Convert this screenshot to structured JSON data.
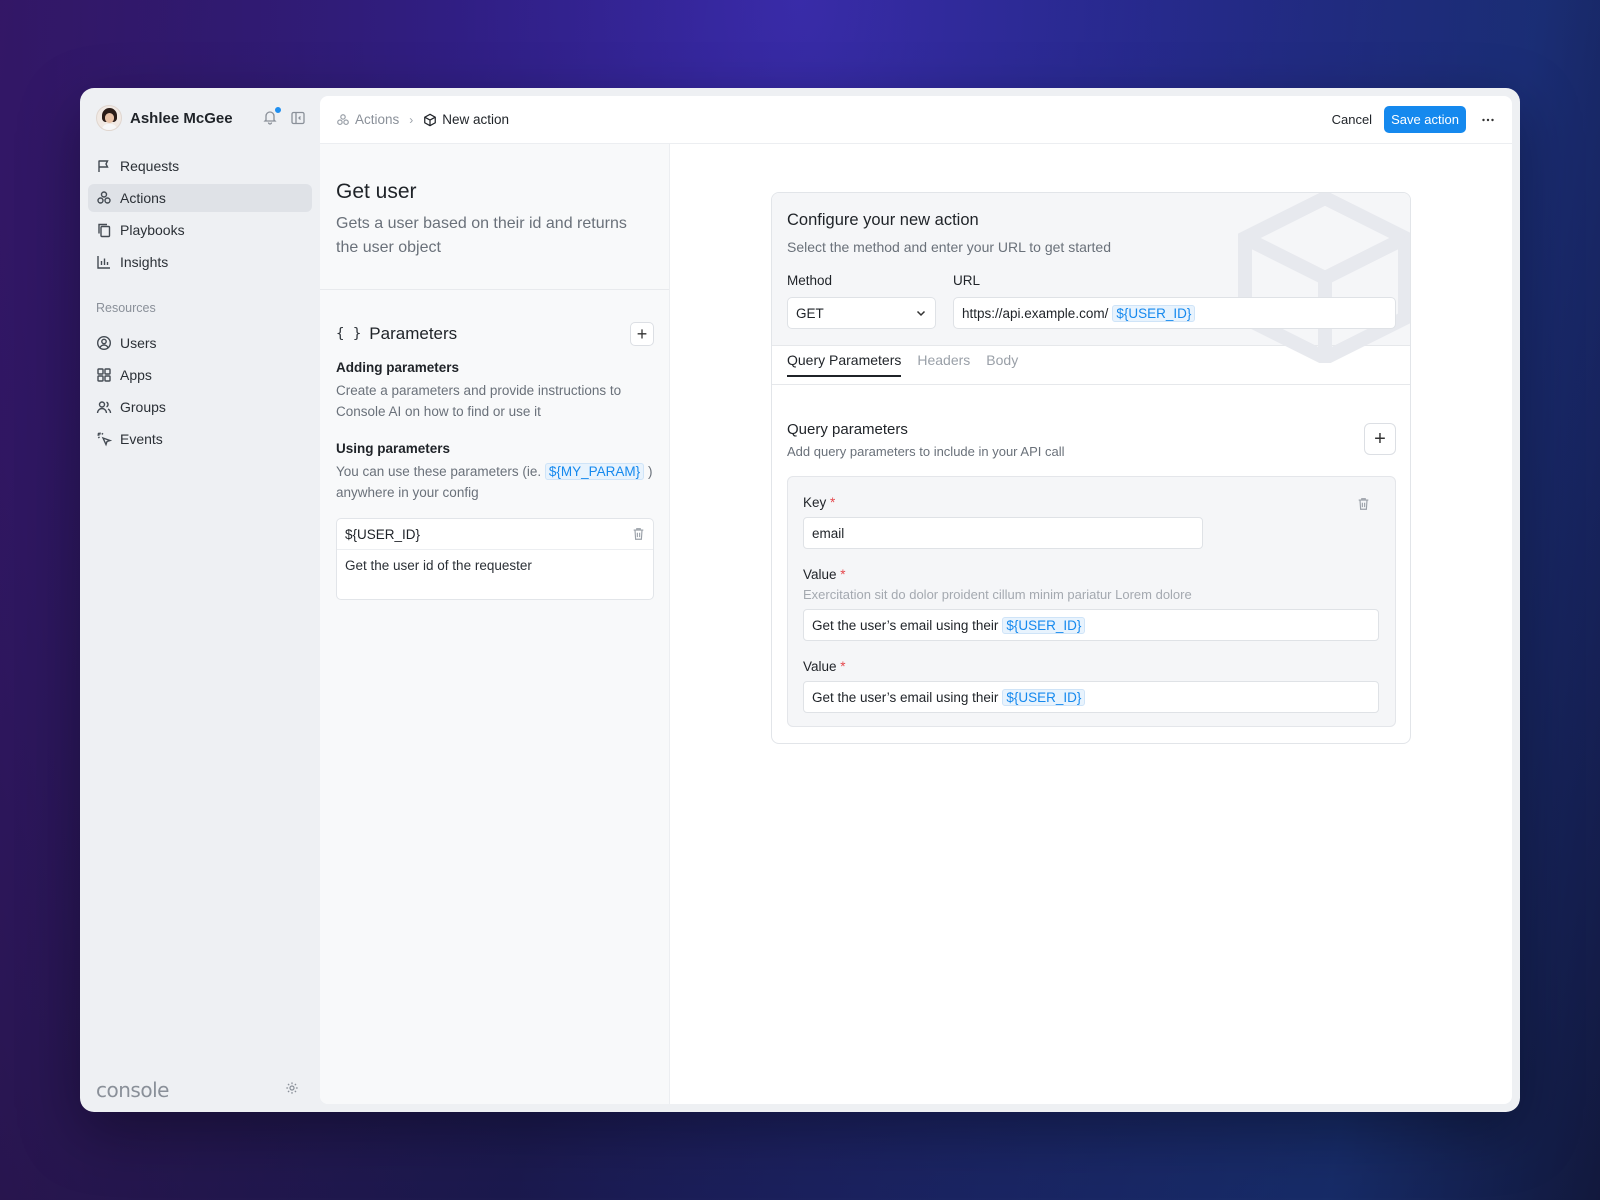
{
  "user": {
    "name": "Ashlee McGee"
  },
  "sidebar": {
    "items": [
      {
        "label": "Requests",
        "icon": "flag-icon"
      },
      {
        "label": "Actions",
        "icon": "actions-icon",
        "active": true
      },
      {
        "label": "Playbooks",
        "icon": "copy-icon"
      },
      {
        "label": "Insights",
        "icon": "bar-chart-icon"
      }
    ],
    "section_label": "Resources",
    "resources": [
      {
        "label": "Users",
        "icon": "user-circle-icon"
      },
      {
        "label": "Apps",
        "icon": "grid-icon"
      },
      {
        "label": "Groups",
        "icon": "users-icon"
      },
      {
        "label": "Events",
        "icon": "pointer-click-icon"
      }
    ],
    "brand": "console"
  },
  "header": {
    "breadcrumb_parent": "Actions",
    "breadcrumb_current": "New action",
    "cancel_label": "Cancel",
    "save_label": "Save action"
  },
  "action": {
    "title": "Get user",
    "description": "Gets a user based on their id and returns the user object"
  },
  "parameters": {
    "title": "Parameters",
    "brace": "{ }",
    "adding_heading": "Adding parameters",
    "adding_text": "Create a parameters and provide instructions to Console AI on how to find or use it",
    "using_heading": "Using parameters",
    "using_text_before": "You can use these parameters (ie.",
    "using_token": "${MY_PARAM}",
    "using_text_after": ")",
    "using_text_end": "anywhere in your config",
    "items": [
      {
        "name": "${USER_ID}",
        "description": "Get the user id of the requester"
      }
    ]
  },
  "config": {
    "title": "Configure your new action",
    "subtitle": "Select the method and enter your URL to get started",
    "method_label": "Method",
    "method_value": "GET",
    "url_label": "URL",
    "url_value": "https://api.example.com/",
    "url_token": "${USER_ID}",
    "tabs": [
      "Query Parameters",
      "Headers",
      "Body"
    ],
    "active_tab": "Query Parameters",
    "qp_title": "Query parameters",
    "qp_subtitle": "Add query parameters to include in your API call",
    "key_label": "Key",
    "required_mark": "*",
    "key_value": "email",
    "value_label": "Value",
    "value_hint": "Exercitation sit do dolor proident cillum minim pariatur Lorem dolore",
    "value1_text": "Get the user’s email using their",
    "value1_token": "${USER_ID}",
    "value2_label": "Value",
    "value2_text": "Get the user’s email using their",
    "value2_token": "${USER_ID}"
  },
  "colors": {
    "accent": "#1589ee",
    "required": "#e5484d"
  }
}
